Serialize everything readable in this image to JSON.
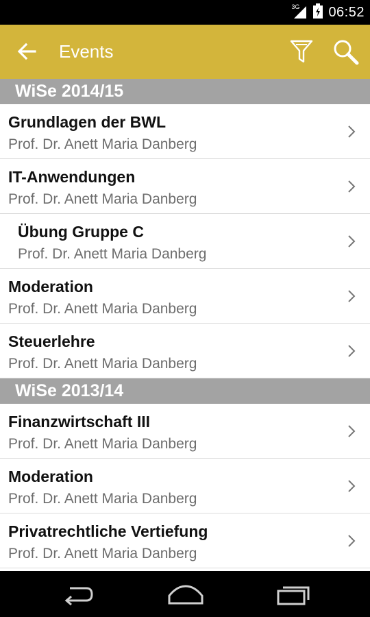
{
  "statusbar": {
    "network": "3G",
    "time": "06:52"
  },
  "appbar": {
    "title": "Events",
    "icons": [
      "back-arrow-icon",
      "filter-icon",
      "search-icon"
    ],
    "color": "#d3b53b"
  },
  "sections": [
    {
      "label": "WiSe 2014/15",
      "items": [
        {
          "title": "Grundlagen der BWL",
          "subtitle": "Prof. Dr. Anett Maria Danberg"
        },
        {
          "title": "IT-Anwendungen",
          "subtitle": "Prof. Dr. Anett Maria Danberg"
        },
        {
          "title": "Übung Gruppe C",
          "subtitle": "Prof. Dr. Anett Maria Danberg"
        },
        {
          "title": "Moderation",
          "subtitle": "Prof. Dr. Anett Maria Danberg"
        },
        {
          "title": "Steuerlehre",
          "subtitle": "Prof. Dr. Anett Maria Danberg"
        }
      ]
    },
    {
      "label": "WiSe 2013/14",
      "items": [
        {
          "title": "Finanzwirtschaft III",
          "subtitle": "Prof. Dr. Anett Maria Danberg"
        },
        {
          "title": "Moderation",
          "subtitle": "Prof. Dr. Anett Maria Danberg"
        },
        {
          "title": "Privatrechtliche Vertiefung",
          "subtitle": "Prof. Dr. Anett Maria Danberg"
        }
      ]
    }
  ],
  "navbar": {
    "icons": [
      "nav-back-icon",
      "nav-home-icon",
      "nav-recent-apps-icon"
    ]
  }
}
